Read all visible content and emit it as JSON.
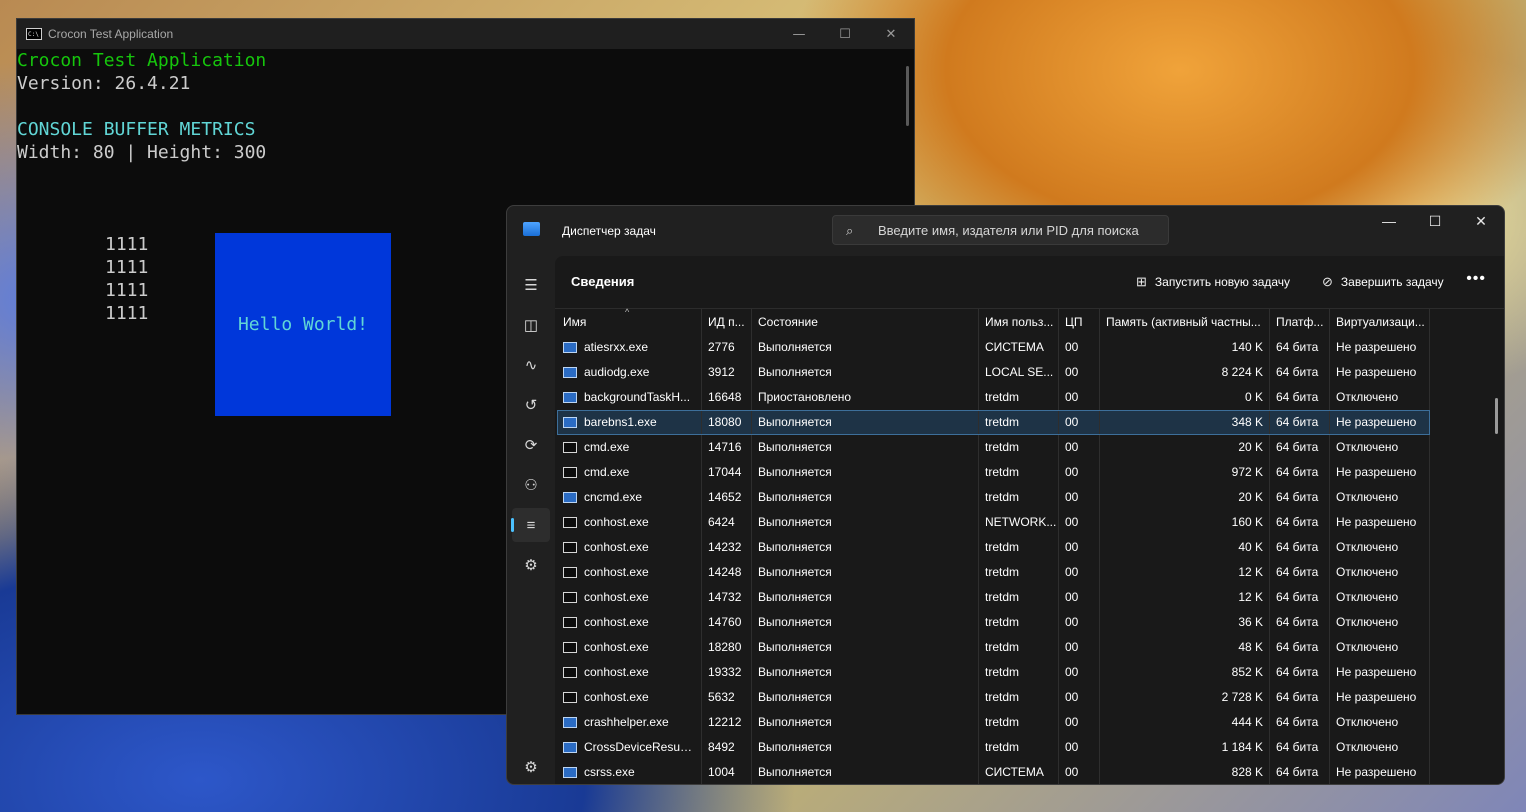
{
  "console": {
    "window_title": "Crocon Test Application",
    "lines": {
      "app_name": "Crocon Test Application",
      "version": "Version: 26.4.21",
      "metrics_title": "CONSOLE BUFFER METRICS",
      "metrics": "Width: 80 | Height: 300"
    },
    "bits": [
      "1111",
      "1111",
      "1111",
      "1111"
    ],
    "hello": "Hello World!",
    "controls": {
      "minimize": "—",
      "maximize": "☐",
      "close": "✕"
    }
  },
  "taskmgr": {
    "title": "Диспетчер задач",
    "search_placeholder": "Введите имя, издателя или PID для поиска",
    "controls": {
      "minimize": "—",
      "maximize": "☐",
      "close": "✕"
    },
    "section": "Сведения",
    "actions": {
      "new_task": "Запустить новую задачу",
      "end_task": "Завершить задачу",
      "more": "•••"
    },
    "nav_icons": [
      "hamburger-icon",
      "processes-icon",
      "performance-icon",
      "history-icon",
      "startup-icon",
      "users-icon",
      "details-icon",
      "services-icon",
      "settings-icon"
    ],
    "columns": {
      "name": "Имя",
      "pid": "ИД п...",
      "state": "Состояние",
      "user": "Имя польз...",
      "cpu": "ЦП",
      "memory": "Память (активный частны...",
      "platform": "Платф...",
      "virtualization": "Виртуализаци..."
    },
    "rows": [
      {
        "name": "atiesrxx.exe",
        "icon": "exe",
        "pid": "2776",
        "state": "Выполняется",
        "user": "СИСТЕМА",
        "cpu": "00",
        "memory": "140 K",
        "platform": "64 бита",
        "virt": "Не разрешено"
      },
      {
        "name": "audiodg.exe",
        "icon": "exe",
        "pid": "3912",
        "state": "Выполняется",
        "user": "LOCAL SE...",
        "cpu": "00",
        "memory": "8 224 K",
        "platform": "64 бита",
        "virt": "Не разрешено"
      },
      {
        "name": "backgroundTaskH...",
        "icon": "exe",
        "pid": "16648",
        "state": "Приостановлено",
        "user": "tretdm",
        "cpu": "00",
        "memory": "0 K",
        "platform": "64 бита",
        "virt": "Отключено"
      },
      {
        "name": "barebns1.exe",
        "icon": "exe",
        "pid": "18080",
        "state": "Выполняется",
        "user": "tretdm",
        "cpu": "00",
        "memory": "348 K",
        "platform": "64 бита",
        "virt": "Не разрешено",
        "selected": true
      },
      {
        "name": "cmd.exe",
        "icon": "console",
        "pid": "14716",
        "state": "Выполняется",
        "user": "tretdm",
        "cpu": "00",
        "memory": "20 K",
        "platform": "64 бита",
        "virt": "Отключено"
      },
      {
        "name": "cmd.exe",
        "icon": "console",
        "pid": "17044",
        "state": "Выполняется",
        "user": "tretdm",
        "cpu": "00",
        "memory": "972 K",
        "platform": "64 бита",
        "virt": "Не разрешено"
      },
      {
        "name": "cncmd.exe",
        "icon": "exe",
        "pid": "14652",
        "state": "Выполняется",
        "user": "tretdm",
        "cpu": "00",
        "memory": "20 K",
        "platform": "64 бита",
        "virt": "Отключено"
      },
      {
        "name": "conhost.exe",
        "icon": "console",
        "pid": "6424",
        "state": "Выполняется",
        "user": "NETWORK...",
        "cpu": "00",
        "memory": "160 K",
        "platform": "64 бита",
        "virt": "Не разрешено"
      },
      {
        "name": "conhost.exe",
        "icon": "console",
        "pid": "14232",
        "state": "Выполняется",
        "user": "tretdm",
        "cpu": "00",
        "memory": "40 K",
        "platform": "64 бита",
        "virt": "Отключено"
      },
      {
        "name": "conhost.exe",
        "icon": "console",
        "pid": "14248",
        "state": "Выполняется",
        "user": "tretdm",
        "cpu": "00",
        "memory": "12 K",
        "platform": "64 бита",
        "virt": "Отключено"
      },
      {
        "name": "conhost.exe",
        "icon": "console",
        "pid": "14732",
        "state": "Выполняется",
        "user": "tretdm",
        "cpu": "00",
        "memory": "12 K",
        "platform": "64 бита",
        "virt": "Отключено"
      },
      {
        "name": "conhost.exe",
        "icon": "console",
        "pid": "14760",
        "state": "Выполняется",
        "user": "tretdm",
        "cpu": "00",
        "memory": "36 K",
        "platform": "64 бита",
        "virt": "Отключено"
      },
      {
        "name": "conhost.exe",
        "icon": "console",
        "pid": "18280",
        "state": "Выполняется",
        "user": "tretdm",
        "cpu": "00",
        "memory": "48 K",
        "platform": "64 бита",
        "virt": "Отключено"
      },
      {
        "name": "conhost.exe",
        "icon": "console",
        "pid": "19332",
        "state": "Выполняется",
        "user": "tretdm",
        "cpu": "00",
        "memory": "852 K",
        "platform": "64 бита",
        "virt": "Не разрешено"
      },
      {
        "name": "conhost.exe",
        "icon": "console",
        "pid": "5632",
        "state": "Выполняется",
        "user": "tretdm",
        "cpu": "00",
        "memory": "2 728 K",
        "platform": "64 бита",
        "virt": "Не разрешено"
      },
      {
        "name": "crashhelper.exe",
        "icon": "exe",
        "pid": "12212",
        "state": "Выполняется",
        "user": "tretdm",
        "cpu": "00",
        "memory": "444 K",
        "platform": "64 бита",
        "virt": "Отключено"
      },
      {
        "name": "CrossDeviceResum...",
        "icon": "exe",
        "pid": "8492",
        "state": "Выполняется",
        "user": "tretdm",
        "cpu": "00",
        "memory": "1 184 K",
        "platform": "64 бита",
        "virt": "Отключено"
      },
      {
        "name": "csrss.exe",
        "icon": "exe",
        "pid": "1004",
        "state": "Выполняется",
        "user": "СИСТЕМА",
        "cpu": "00",
        "memory": "828 K",
        "platform": "64 бита",
        "virt": "Не разрешено"
      }
    ]
  }
}
